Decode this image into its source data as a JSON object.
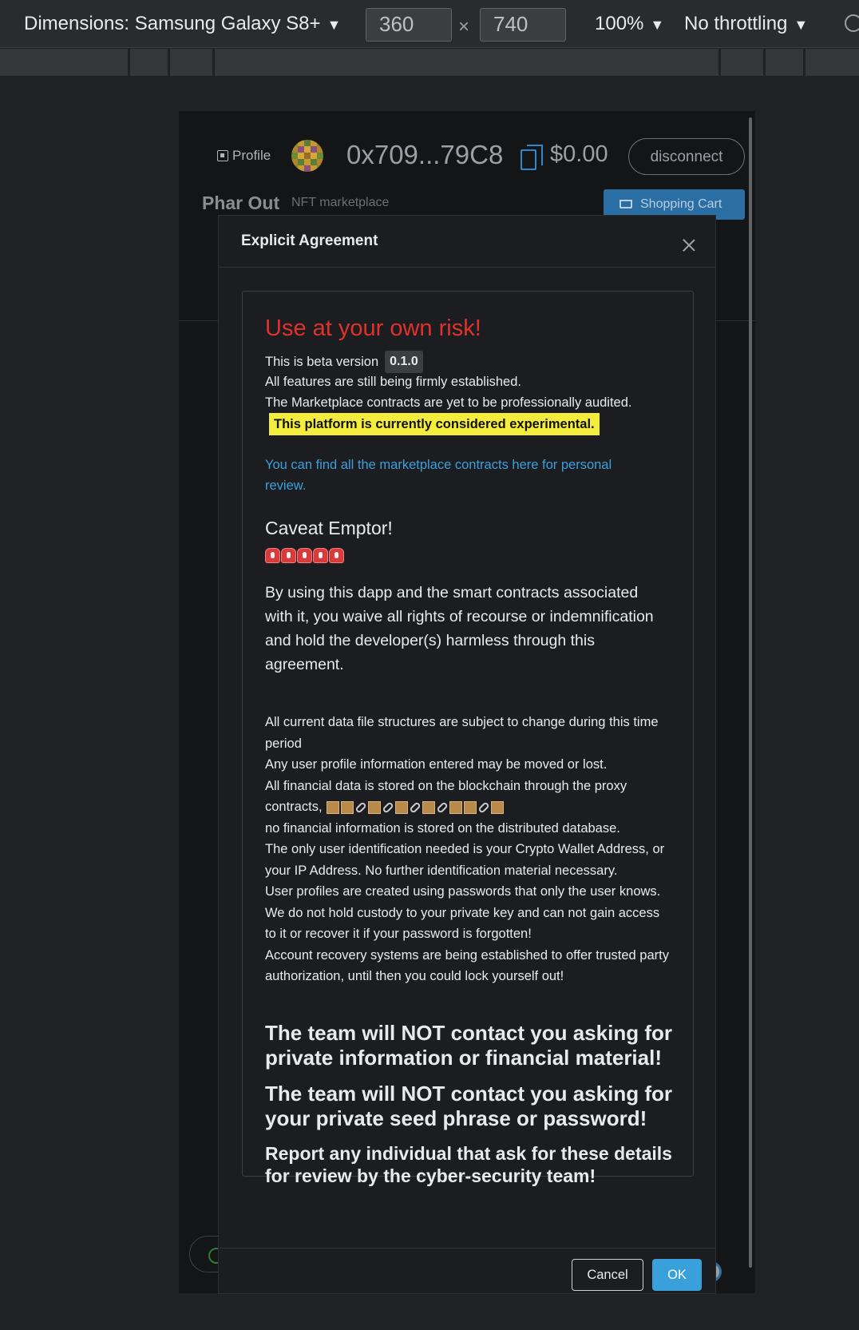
{
  "devtools": {
    "dimensions_label": "Dimensions: Samsung Galaxy S8+",
    "width": "360",
    "height": "740",
    "times": "×",
    "zoom": "100%",
    "throttling": "No throttling"
  },
  "header": {
    "profile_label": "Profile",
    "address": "0x709...79C8",
    "balance": "$0.00",
    "disconnect_label": "disconnect",
    "brand": "Phar Out",
    "brand_subtitle": "NFT marketplace",
    "cart_label": "Shopping Cart"
  },
  "modal": {
    "title": "Explicit Agreement",
    "risk_heading": "Use at your own risk!",
    "beta_prefix": "This is beta version",
    "version": "0.1.0",
    "line_features": "All features are still being firmly established.",
    "line_audit": "The Marketplace contracts are yet to be professionally audited.",
    "experimental": "This platform is currently considered experimental.",
    "contracts_link": "You can find all the marketplace contracts here for personal review.",
    "caveat": "Caveat Emptor!",
    "siren_count": 5,
    "waiver": "By using this dapp and the smart contracts associated with it, you waive all rights of recourse or indemnification and hold the developer(s) harmless through this agreement.",
    "fine_1": "All current data file structures are subject to change during this time period",
    "fine_2": "Any user profile information entered may be moved or lost.",
    "fine_3": "All financial data is stored on the blockchain through the proxy contracts,",
    "fine_4": "no financial information is stored on the distributed database.",
    "fine_5": "The only user identification needed is your Crypto Wallet Address, or your IP Address. No further identification material necessary.",
    "fine_6": "User profiles are created using passwords that only the user knows. We do not hold custody to your private key and can not gain access to it or recover it if your password is forgotten!",
    "fine_7": "Account recovery systems are being established to offer trusted party authorization, until then you could lock yourself out!",
    "warn_1": "The team will NOT contact you asking for private information or financial material!",
    "warn_2": "The team will NOT contact you asking for your private seed phrase or password!",
    "report": "Report any individual that ask for these details for review by the cyber-security team!",
    "cancel_label": "Cancel",
    "ok_label": "OK"
  },
  "colors": {
    "risk_red": "#e0322b",
    "link_blue": "#3aa0dc",
    "highlight_yellow": "#f5ed3b",
    "ok_blue": "#3aa0dc"
  }
}
